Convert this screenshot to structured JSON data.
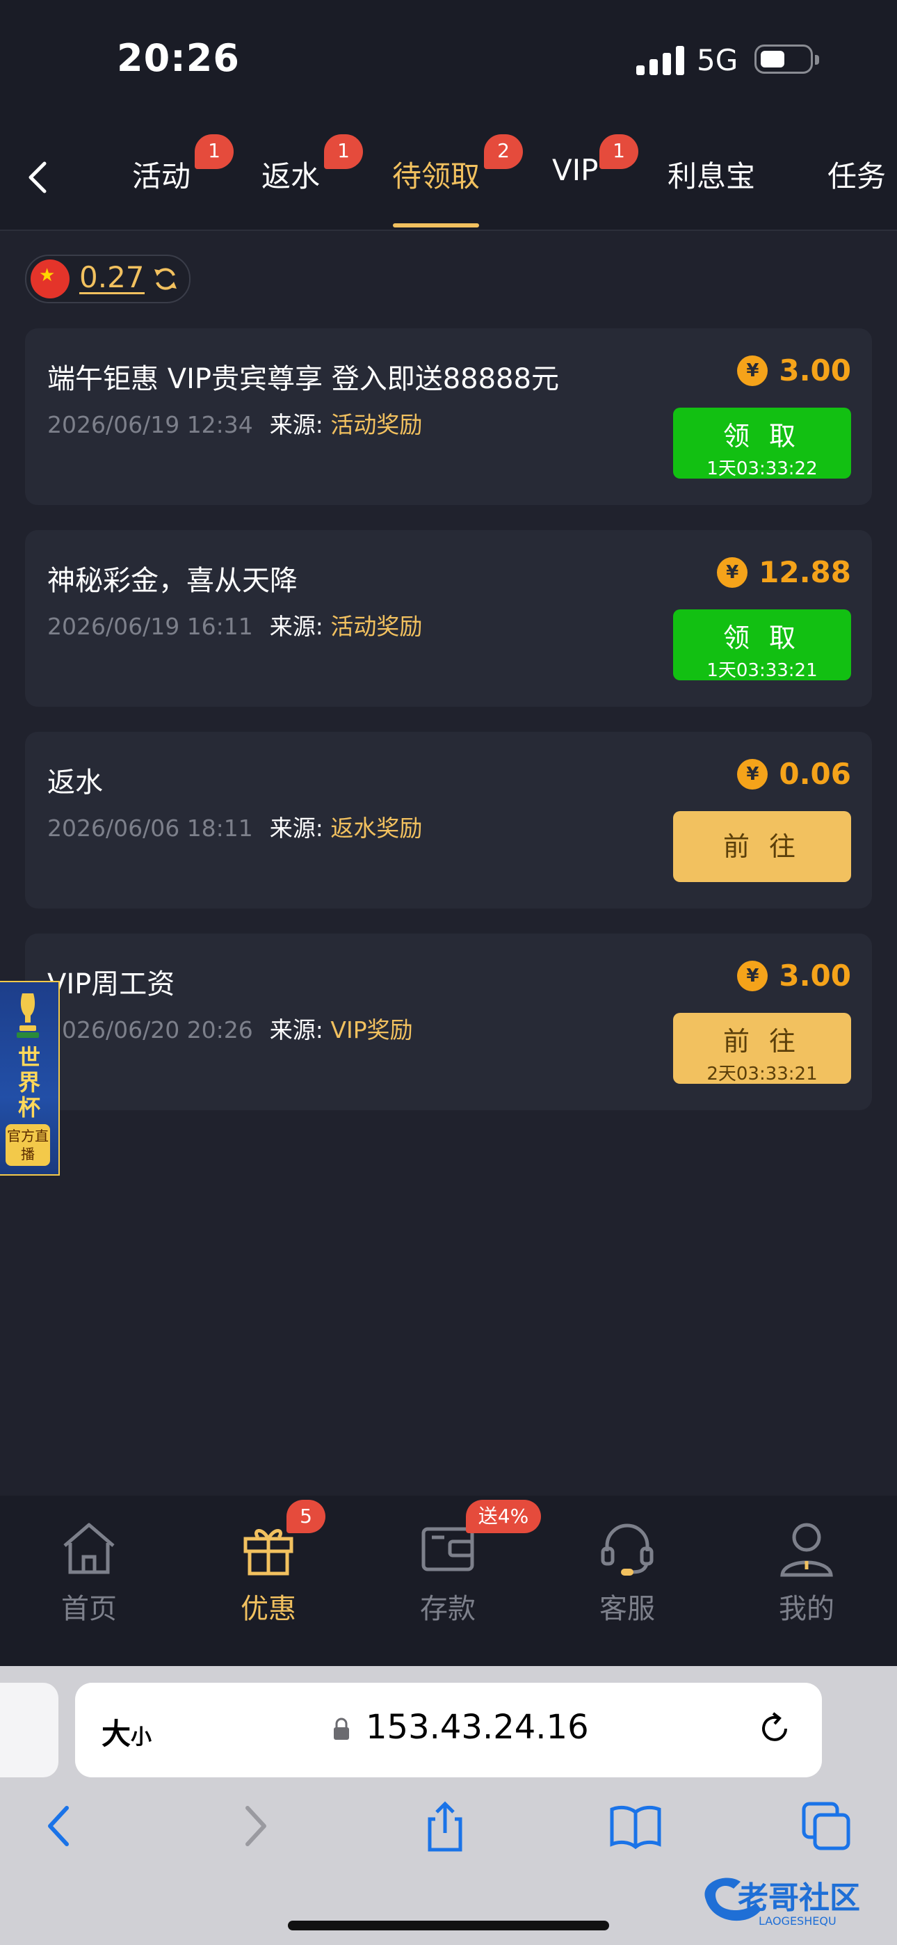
{
  "status": {
    "time": "20:26",
    "network": "5G"
  },
  "tabs": [
    {
      "label": "活动",
      "badge": "1"
    },
    {
      "label": "返水",
      "badge": "1"
    },
    {
      "label": "待领取",
      "badge": "2"
    },
    {
      "label": "VIP",
      "badge": "1"
    },
    {
      "label": "利息宝"
    },
    {
      "label": "任务"
    }
  ],
  "balance": {
    "value": "0.27"
  },
  "rewards": [
    {
      "title": "端午钜惠 VIP贵宾尊享 登入即送88888元",
      "date": "2026/06/19 12:34",
      "source_label": "来源:",
      "source": "活动奖励",
      "amount": "3.00",
      "button": "领 取",
      "countdown": "1天03:33:22"
    },
    {
      "title": "神秘彩金，喜从天降",
      "date": "2026/06/19 16:11",
      "source_label": "来源:",
      "source": "活动奖励",
      "amount": "12.88",
      "button": "领 取",
      "countdown": "1天03:33:21"
    },
    {
      "title": "返水",
      "date": "2026/06/06 18:11",
      "source_label": "来源:",
      "source": "返水奖励",
      "amount": "0.06",
      "button": "前 往"
    },
    {
      "title": "VIP周工资",
      "date": "2026/06/20 20:26",
      "source_label": "来源:",
      "source": "VIP奖励",
      "amount": "3.00",
      "button": "前 往",
      "countdown": "2天03:33:21"
    }
  ],
  "coin_symbol": "¥",
  "world_cup": {
    "title": "世界杯",
    "tag": "官方直播"
  },
  "bottom_nav": [
    {
      "label": "首页",
      "icon": "home-icon"
    },
    {
      "label": "优惠",
      "icon": "gift-icon",
      "badge": "5"
    },
    {
      "label": "存款",
      "icon": "wallet-icon",
      "badge": "送4%"
    },
    {
      "label": "客服",
      "icon": "headset-icon"
    },
    {
      "label": "我的",
      "icon": "user-icon"
    }
  ],
  "browser": {
    "text_size": "大",
    "text_size_small": "小",
    "url": "153.43.24.16"
  },
  "watermark": {
    "title": "老哥社区",
    "sub": "LAOGESHEQU"
  },
  "colors": {
    "accent": "#f2c15f",
    "green": "#12c012",
    "badge": "#e54b3c",
    "coin": "#f5a31a"
  }
}
